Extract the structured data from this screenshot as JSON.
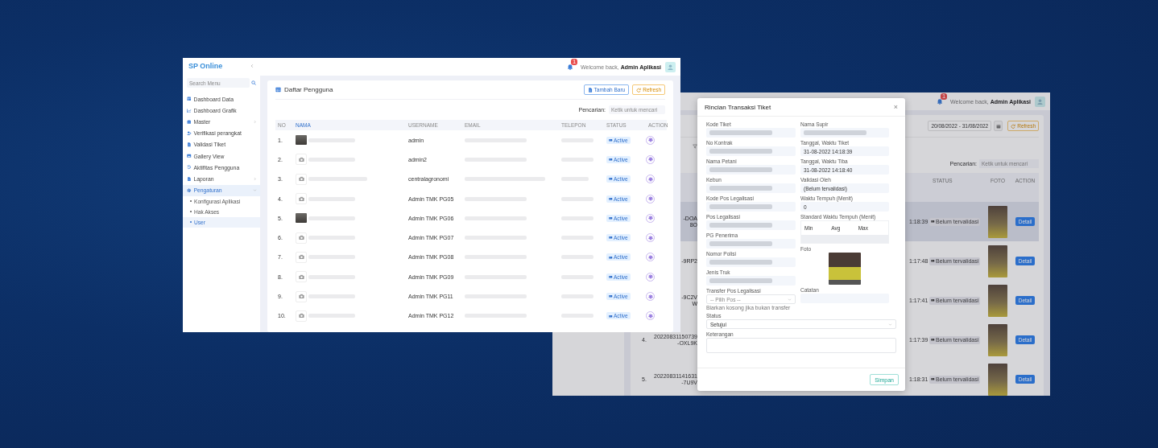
{
  "user_window": {
    "sidebar": {
      "brand": "SP Online",
      "search": {
        "placeholder": "Search Menu"
      },
      "items": [
        {
          "label": "Dashboard Data",
          "kind": "link",
          "selected": false
        },
        {
          "label": "Dashboard Grafik",
          "kind": "link",
          "selected": false
        },
        {
          "label": "Master",
          "kind": "group",
          "expanded": false,
          "selected": false
        },
        {
          "label": "Verifikasi perangkat",
          "kind": "link",
          "selected": false
        },
        {
          "label": "Validasi Tiket",
          "kind": "link",
          "selected": false
        },
        {
          "label": "Gallery View",
          "kind": "link",
          "selected": false
        },
        {
          "label": "Aktifitas Pengguna",
          "kind": "link",
          "selected": false
        },
        {
          "label": "Laporan",
          "kind": "group",
          "expanded": false,
          "selected": false
        },
        {
          "label": "Pengaturan",
          "kind": "group",
          "expanded": true,
          "selected": true,
          "children": [
            {
              "label": "Konfigurasi Aplikasi",
              "selected": false
            },
            {
              "label": "Hak Akses",
              "selected": false
            },
            {
              "label": "User",
              "selected": true
            }
          ]
        }
      ]
    },
    "topbar": {
      "notification_count": "1",
      "welcome": "Welcome back, **Admin Aplikasi**"
    },
    "panel": {
      "title": "Daftar Pengguna",
      "buttons": [
        {
          "label": "Tambah Baru",
          "kind": "primary"
        },
        {
          "label": "Refresh",
          "kind": "warning"
        }
      ],
      "search": {
        "label": "Pencarian:",
        "placeholder": "Ketik untuk mencari"
      },
      "columns": [
        "NO",
        "NAMA",
        "USERNAME",
        "EMAIL",
        "TELEPON",
        "STATUS",
        "ACTION"
      ],
      "rows": [
        {
          "no": "1.",
          "kind": "photo",
          "username": "admin",
          "status": "Active"
        },
        {
          "no": "2.",
          "kind": "placeholder",
          "username": "admin2",
          "status": "Active"
        },
        {
          "no": "3.",
          "kind": "placeholder",
          "username": "centralagronomi",
          "status": "Active"
        },
        {
          "no": "4.",
          "kind": "placeholder",
          "username": "Admin TMK PG05",
          "status": "Active"
        },
        {
          "no": "5.",
          "kind": "photo",
          "username": "Admin TMK PG06",
          "status": "Active"
        },
        {
          "no": "6.",
          "kind": "placeholder",
          "username": "Admin TMK PG07",
          "status": "Active"
        },
        {
          "no": "7.",
          "kind": "placeholder",
          "username": "Admin TMK PG08",
          "status": "Active"
        },
        {
          "no": "8.",
          "kind": "placeholder",
          "username": "Admin TMK PG09",
          "status": "Active"
        },
        {
          "no": "9.",
          "kind": "placeholder",
          "username": "Admin TMK PG11",
          "status": "Active"
        },
        {
          "no": "10.",
          "kind": "placeholder",
          "username": "Admin TMK PG12",
          "status": "Active"
        }
      ]
    }
  },
  "ticket_window": {
    "topbar": {
      "notification_count": "1",
      "welcome": "Welcome back, **Admin Aplikasi**"
    },
    "date_range": "20/08/2022 - 31/08/2022",
    "refresh": "Refresh",
    "search": {
      "label": "Pencarian:",
      "placeholder": "Ketik untuk mencari"
    },
    "table": {
      "columns": [
        "STATUS",
        "FOTO",
        "ACTION"
      ],
      "rows": [
        {
          "code": "-DOA8O",
          "time": "1:18:39",
          "status": "Belum tervalidasi",
          "action": "Detail",
          "selected": true
        },
        {
          "code": "-9RP2",
          "time": "1:17:48",
          "status": "Belum tervalidasi",
          "action": "Detail",
          "selected": false
        },
        {
          "code": "-9C2VW",
          "time": "1:17:41",
          "status": "Belum tervalidasi",
          "action": "Detail",
          "selected": false
        },
        {
          "no": "4.",
          "code": "20220831150739-OXL9K",
          "time": "1:17:39",
          "status": "Belum tervalidasi",
          "action": "Detail",
          "selected": false
        },
        {
          "no": "5.",
          "code": "20220831141631-7U9V",
          "time": "1:18:31",
          "status": "Belum tervalidasi",
          "action": "Detail",
          "selected": false
        }
      ]
    },
    "modal": {
      "title": "Rincian Transaksi Tiket",
      "close": "×",
      "left_fields": [
        {
          "label": "Kode Tiket",
          "kind": "text",
          "redacted": true
        },
        {
          "label": "No Kontrak",
          "kind": "text",
          "redacted": true
        },
        {
          "label": "Nama Petani",
          "kind": "text",
          "redacted": true
        },
        {
          "label": "Kebun",
          "kind": "text",
          "redacted": true
        },
        {
          "label": "Kode Pos Legalisasi",
          "kind": "text",
          "redacted": true
        },
        {
          "label": "Pos Legalisasi",
          "kind": "text",
          "redacted": true
        },
        {
          "label": "PG Penerima",
          "kind": "text",
          "redacted": true
        },
        {
          "label": "Nomor Polisi",
          "kind": "text",
          "redacted": true
        },
        {
          "label": "Jenis Truk",
          "kind": "text",
          "redacted": true
        },
        {
          "label": "Transfer Pos Legalisasi",
          "kind": "select",
          "placeholder": "-- Pilih Pos --",
          "help": "Biarkan kosong jika bukan transfer"
        }
      ],
      "right_fields": [
        {
          "label": "Nama Supir",
          "kind": "text",
          "redacted": true
        },
        {
          "label": "Tanggal, Waktu Tiket",
          "kind": "text",
          "redacted": false,
          "value": "31-08-2022 14:18:39"
        },
        {
          "label": "Tanggal, Waktu Tiba",
          "kind": "text",
          "redacted": false,
          "value": "31-08-2022 14:18:40"
        },
        {
          "label": "Validasi Oleh",
          "kind": "text",
          "redacted": false,
          "value": "(Belum tervalidasi)"
        },
        {
          "label": "Waktu Tempuh (Menit)",
          "kind": "text",
          "redacted": false,
          "value": "0"
        },
        {
          "label": "Standard Waktu Tempuh (Menit)",
          "kind": "table",
          "columns": [
            "Min",
            "Avg",
            "Max"
          ]
        },
        {
          "label": "Foto",
          "kind": "photo"
        },
        {
          "label": "Catatan",
          "kind": "text",
          "redacted": false
        }
      ],
      "status": {
        "label": "Status",
        "value": "Setujui"
      },
      "note": {
        "label": "Keterangan"
      },
      "save": "Simpan"
    }
  }
}
